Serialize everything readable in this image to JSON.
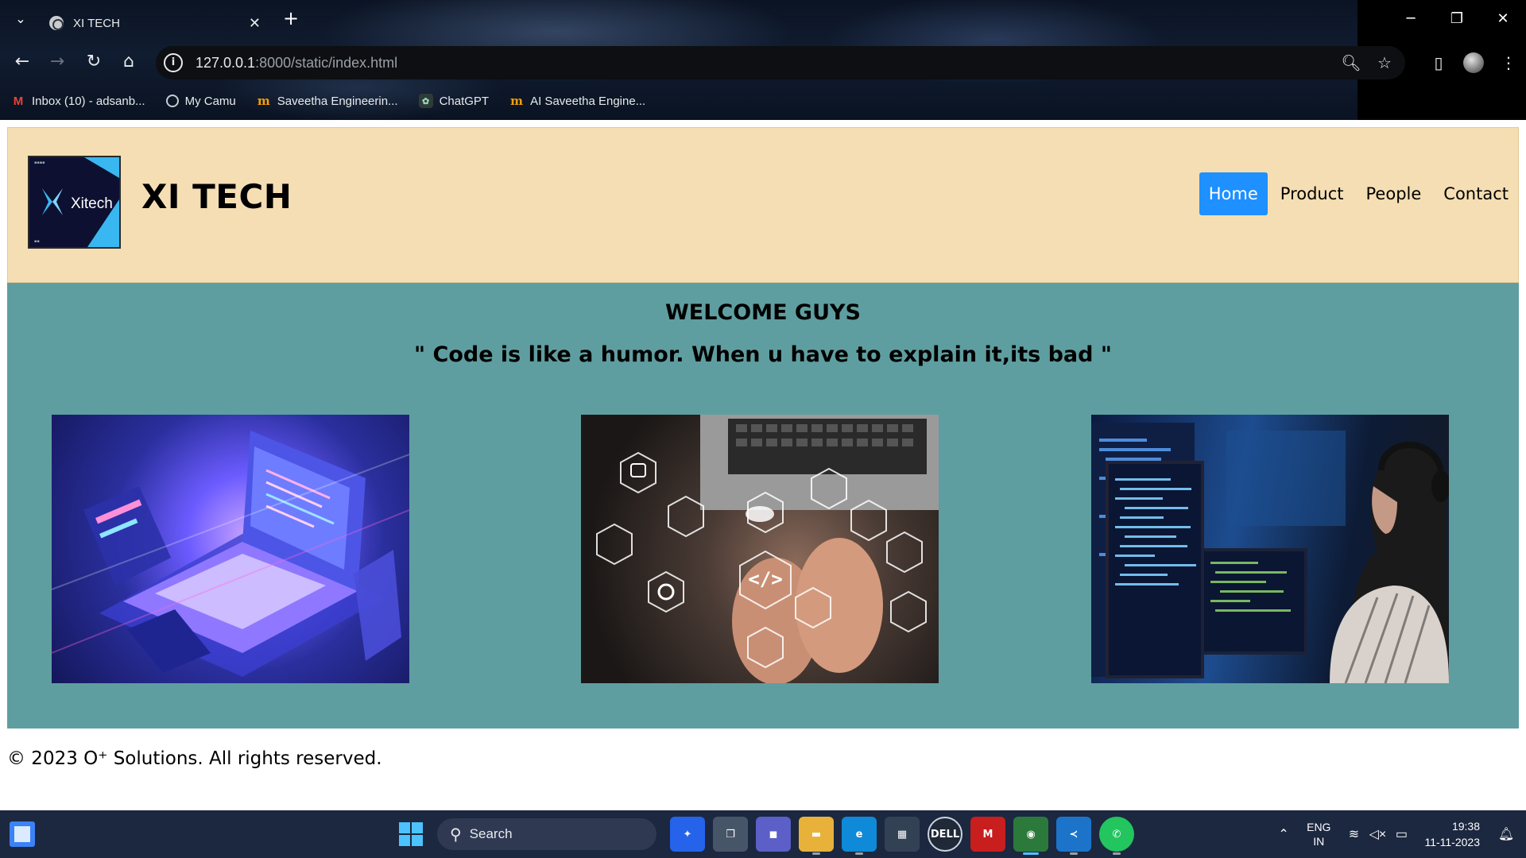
{
  "browser": {
    "tab_title": "XI TECH",
    "url_host": "127.0.0.1",
    "url_rest": ":8000/static/index.html",
    "bookmarks": [
      {
        "label": "Inbox (10) - adsanb...",
        "icon": "gmail-icon"
      },
      {
        "label": "My Camu",
        "icon": "globe-icon"
      },
      {
        "label": "Saveetha Engineerin...",
        "icon": "moodle-icon"
      },
      {
        "label": "ChatGPT",
        "icon": "chatgpt-icon"
      },
      {
        "label": "AI Saveetha Engine...",
        "icon": "moodle-icon"
      }
    ]
  },
  "site": {
    "logo_text": "Xitech",
    "brand": "XI TECH",
    "nav": [
      {
        "label": "Home",
        "active": true
      },
      {
        "label": "Product",
        "active": false
      },
      {
        "label": "People",
        "active": false
      },
      {
        "label": "Contact",
        "active": false
      }
    ],
    "welcome": "WELCOME GUYS",
    "quote": "\" Code is like a humor. When u have to explain it,its bad \"",
    "images": [
      {
        "subject": "isometric laptop with dashboards"
      },
      {
        "subject": "hands on laptop with tech icons"
      },
      {
        "subject": "woman coding at monitors"
      }
    ],
    "footer": "© 2023 O⁺ Solutions. All rights reserved."
  },
  "taskbar": {
    "search_placeholder": "Search",
    "lang_top": "ENG",
    "lang_bottom": "IN",
    "time": "19:38",
    "date": "11-11-2023"
  },
  "colors": {
    "header_bg": "#f5deb3",
    "hero_bg": "#5f9ea0",
    "nav_active": "#1e90ff"
  }
}
